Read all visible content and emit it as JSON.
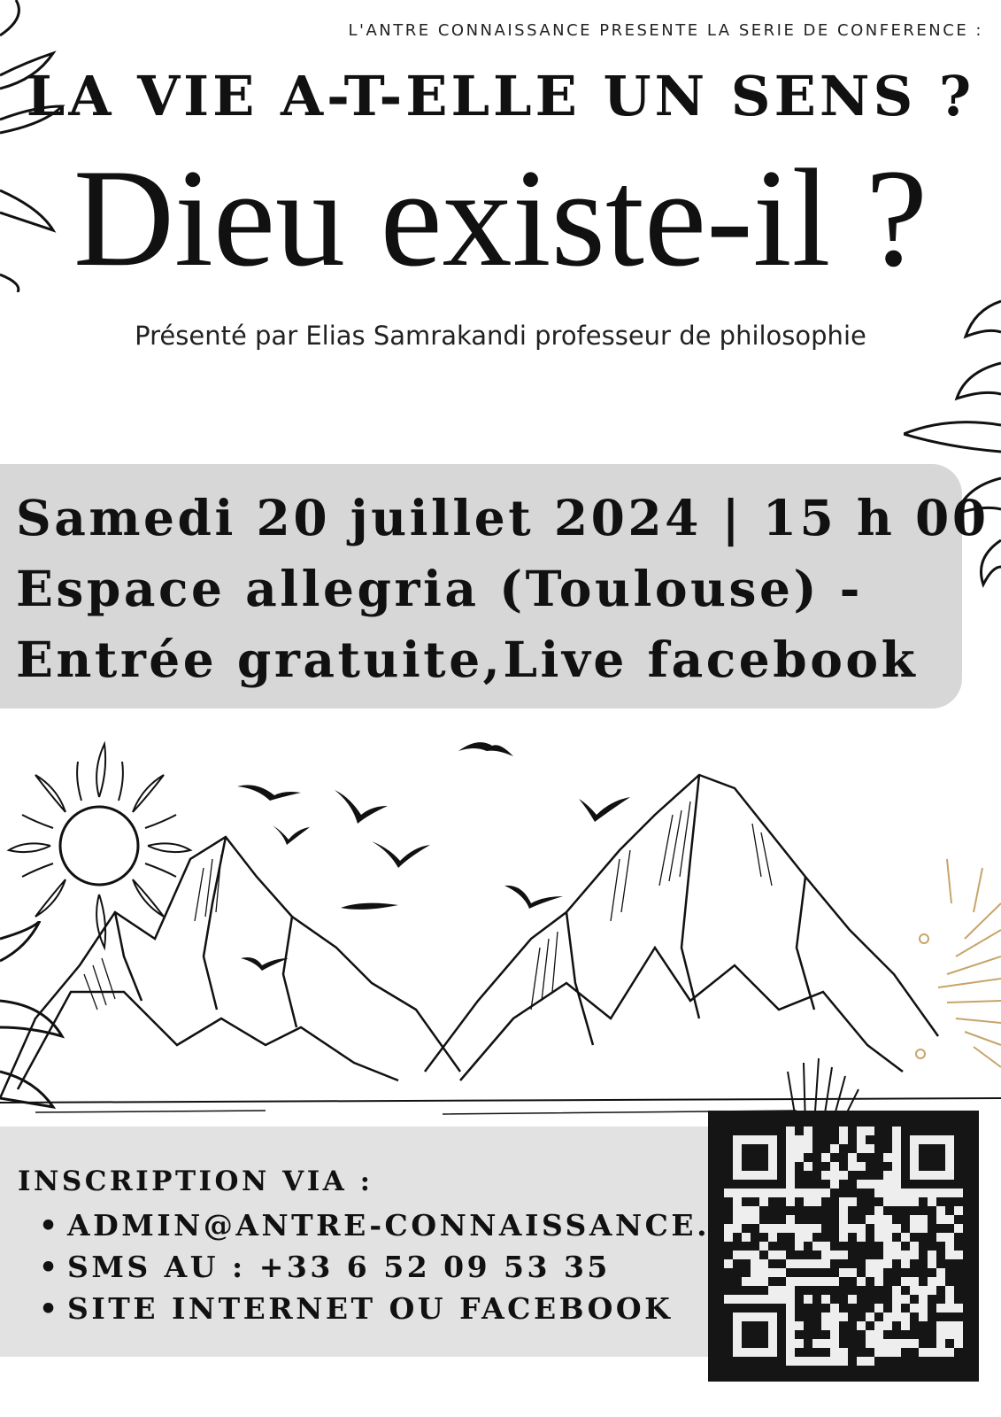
{
  "header": {
    "kicker": "L'ANTRE CONNAISSANCE PRESENTE LA SERIE DE CONFERENCE :",
    "series_title": "LA VIE A-T-ELLE UN SENS ?",
    "main_title": "Dieu existe-il ?",
    "presenter": "Présenté par Elias Samrakandi professeur de philosophie"
  },
  "event": {
    "date_time": "Samedi 20 juillet 2024 | 15 h 00",
    "place": "Espace allegria (Toulouse) -",
    "entry": "Entrée gratuite,Live facebook"
  },
  "registration": {
    "title": "INSCRIPTION VIA :",
    "items": [
      "ADMIN@ANTRE-CONNAISSANCE.FR",
      "SMS AU : +33 6 52 09 53 35",
      "SITE INTERNET OU FACEBOOK"
    ]
  },
  "icons": {
    "bullet": "•",
    "sun": "sun-icon",
    "birds": "bird-icon",
    "qr": "qr-code"
  },
  "colors": {
    "ink": "#111111",
    "panel": "#d7d7d7",
    "gold": "#c8a46a"
  }
}
